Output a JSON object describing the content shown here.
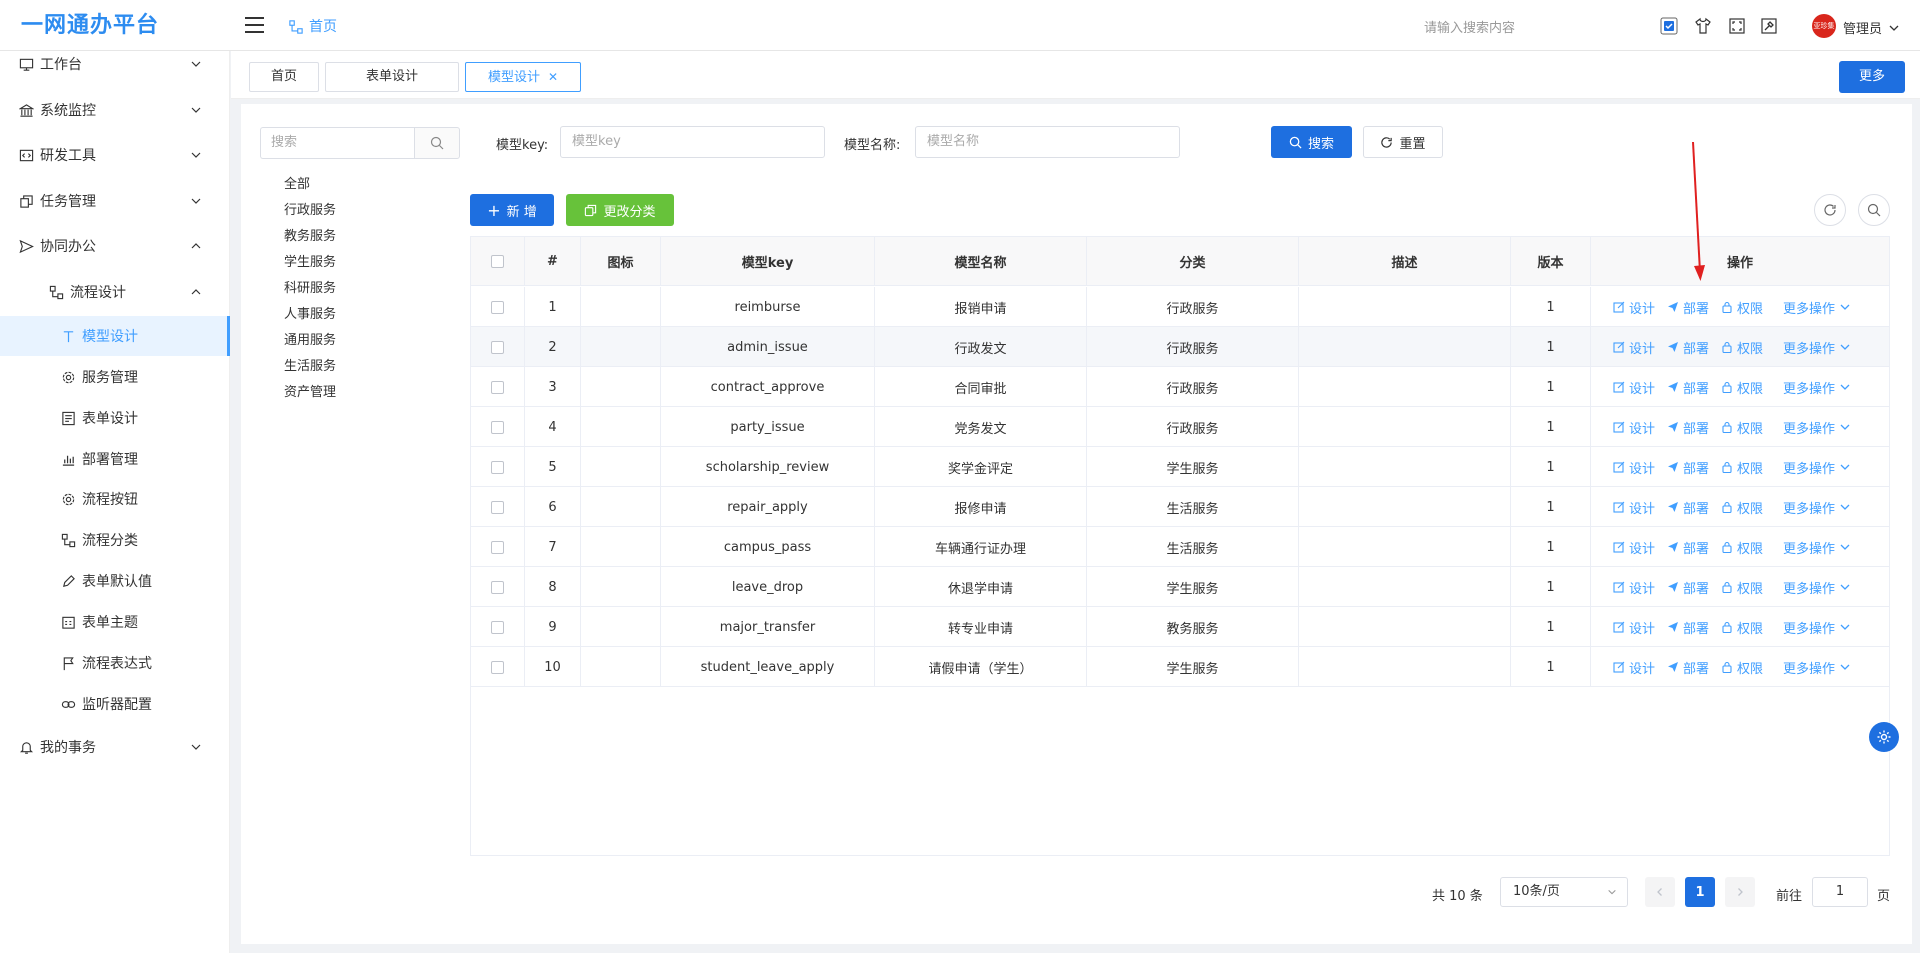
{
  "header": {
    "logo": "一网通办平台",
    "breadcrumb": "首页",
    "search_placeholder": "请输入搜索内容",
    "user_name": "管理员",
    "avatar_text": "亚珍集团"
  },
  "sidebar": {
    "items": [
      {
        "label": "工作台",
        "icon": "monitor-icon",
        "level": 1
      },
      {
        "label": "系统监控",
        "icon": "bank-icon",
        "level": 1
      },
      {
        "label": "研发工具",
        "icon": "code-icon",
        "level": 1
      },
      {
        "label": "任务管理",
        "icon": "copy-icon",
        "level": 1
      },
      {
        "label": "协同办公",
        "icon": "send-icon",
        "level": 1
      },
      {
        "label": "流程设计",
        "icon": "flow-icon",
        "level": 2
      },
      {
        "label": "模型设计",
        "icon": "type-icon",
        "level": 3
      },
      {
        "label": "服务管理",
        "icon": "gear-icon",
        "level": 3
      },
      {
        "label": "表单设计",
        "icon": "form-icon",
        "level": 3
      },
      {
        "label": "部署管理",
        "icon": "chart-icon",
        "level": 3
      },
      {
        "label": "流程按钮",
        "icon": "gear-icon",
        "level": 3
      },
      {
        "label": "流程分类",
        "icon": "flow-icon",
        "level": 3
      },
      {
        "label": "表单默认值",
        "icon": "edit-icon",
        "level": 3
      },
      {
        "label": "表单主题",
        "icon": "calendar-icon",
        "level": 3
      },
      {
        "label": "流程表达式",
        "icon": "flag-icon",
        "level": 3
      },
      {
        "label": "监听器配置",
        "icon": "link-icon",
        "level": 3
      },
      {
        "label": "我的事务",
        "icon": "bell-icon",
        "level": 1
      }
    ]
  },
  "tabs": [
    {
      "label": "首页"
    },
    {
      "label": "表单设计"
    },
    {
      "label": "模型设计"
    }
  ],
  "more_button": "更多",
  "category": {
    "search_placeholder": "搜索",
    "items": [
      "全部",
      "行政服务",
      "教务服务",
      "学生服务",
      "科研服务",
      "人事服务",
      "通用服务",
      "生活服务",
      "资产管理"
    ]
  },
  "filter": {
    "key_label": "模型key:",
    "key_placeholder": "模型key",
    "name_label": "模型名称:",
    "name_placeholder": "模型名称",
    "search_button": "搜索",
    "reset_button": "重置"
  },
  "actions": {
    "add_button": "新 增",
    "change_category_button": "更改分类"
  },
  "table": {
    "columns": [
      "#",
      "图标",
      "模型key",
      "模型名称",
      "分类",
      "描述",
      "版本",
      "操作"
    ],
    "op_design": "设计",
    "op_deploy": "部署",
    "op_permission": "权限",
    "op_more": "更多操作",
    "rows": [
      {
        "no": "1",
        "key": "reimburse",
        "name": "报销申请",
        "category": "行政服务",
        "desc": "",
        "version": "1"
      },
      {
        "no": "2",
        "key": "admin_issue",
        "name": "行政发文",
        "category": "行政服务",
        "desc": "",
        "version": "1"
      },
      {
        "no": "3",
        "key": "contract_approve",
        "name": "合同审批",
        "category": "行政服务",
        "desc": "",
        "version": "1"
      },
      {
        "no": "4",
        "key": "party_issue",
        "name": "党务发文",
        "category": "行政服务",
        "desc": "",
        "version": "1"
      },
      {
        "no": "5",
        "key": "scholarship_review",
        "name": "奖学金评定",
        "category": "学生服务",
        "desc": "",
        "version": "1"
      },
      {
        "no": "6",
        "key": "repair_apply",
        "name": "报修申请",
        "category": "生活服务",
        "desc": "",
        "version": "1"
      },
      {
        "no": "7",
        "key": "campus_pass",
        "name": "车辆通行证办理",
        "category": "生活服务",
        "desc": "",
        "version": "1"
      },
      {
        "no": "8",
        "key": "leave_drop",
        "name": "休退学申请",
        "category": "学生服务",
        "desc": "",
        "version": "1"
      },
      {
        "no": "9",
        "key": "major_transfer",
        "name": "转专业申请",
        "category": "教务服务",
        "desc": "",
        "version": "1"
      },
      {
        "no": "10",
        "key": "student_leave_apply",
        "name": "请假申请（学生）",
        "category": "学生服务",
        "desc": "",
        "version": "1"
      }
    ]
  },
  "pagination": {
    "total": "共 10 条",
    "page_size": "10条/页",
    "current_page": "1",
    "goto_label": "前往",
    "goto_value": "1",
    "page_suffix": "页"
  },
  "colors": {
    "primary": "#1e6fe0",
    "link": "#409eff",
    "green": "#67c23a",
    "annotation_arrow": "#e02020"
  }
}
